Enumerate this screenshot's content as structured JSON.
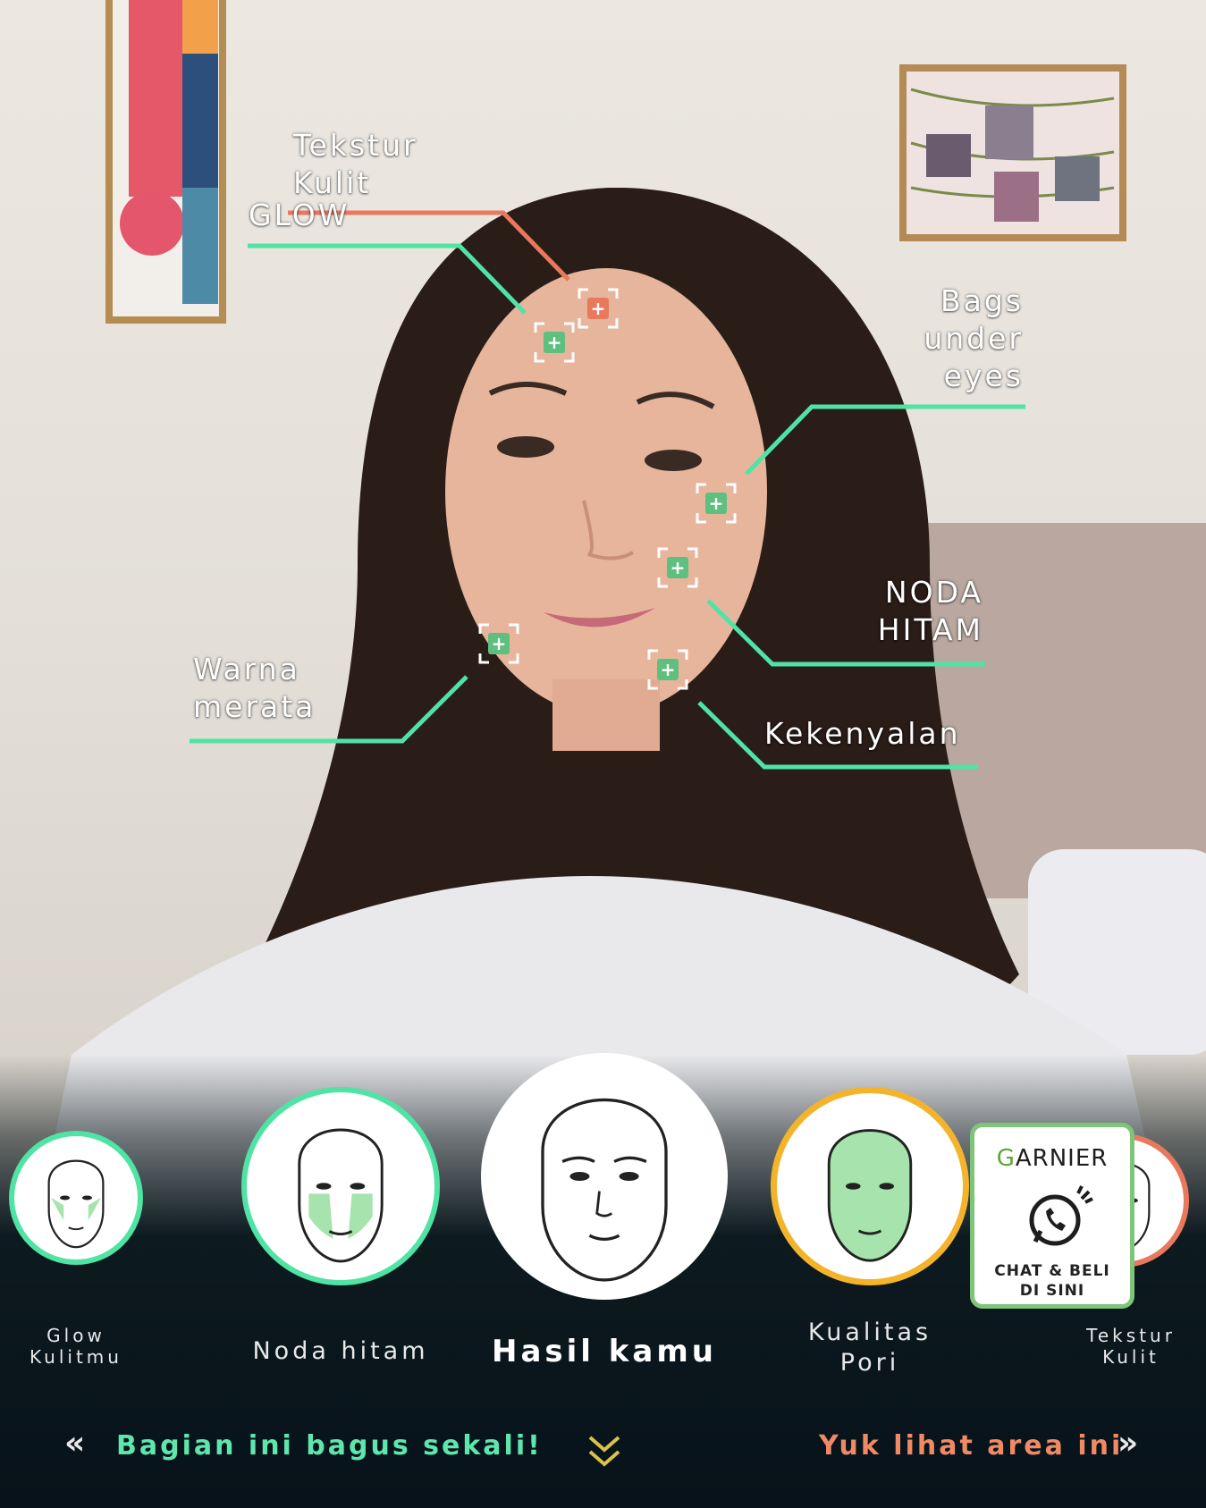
{
  "zones": {
    "tekstur_kulit": "Tekstur\nKulit",
    "glow": "GLOW",
    "bags_under_eyes": "Bags\nunder\neyes",
    "noda_hitam": "NODA\nHITAM",
    "warna_merata": "Warna\nmerata",
    "kekenyalan": "Kekenyalan"
  },
  "markers": {
    "plus_symbol": "+"
  },
  "carousel": {
    "items": [
      {
        "label": "Glow\nKulitmu"
      },
      {
        "label": "Noda hitam"
      },
      {
        "label": "Hasil kamu"
      },
      {
        "label": "Kualitas\nPori"
      },
      {
        "label": "Tekstur\nKulit"
      }
    ]
  },
  "garnier": {
    "logo_g": "G",
    "logo_rest": "ARNIER",
    "cta": "CHAT & BELI\nDI SINI"
  },
  "nav": {
    "left_chevron": "«",
    "left_text": "Bagian ini bagus sekali!",
    "right_text": "Yuk lihat area ini",
    "right_chevron": "»",
    "down_icon": "double-chevron-down"
  },
  "colors": {
    "good": "#4fe3a4",
    "attention": "#e8795d",
    "quality": "#f3b42c",
    "nav_left": "#5ee6ad",
    "nav_right": "#ef8a65"
  }
}
